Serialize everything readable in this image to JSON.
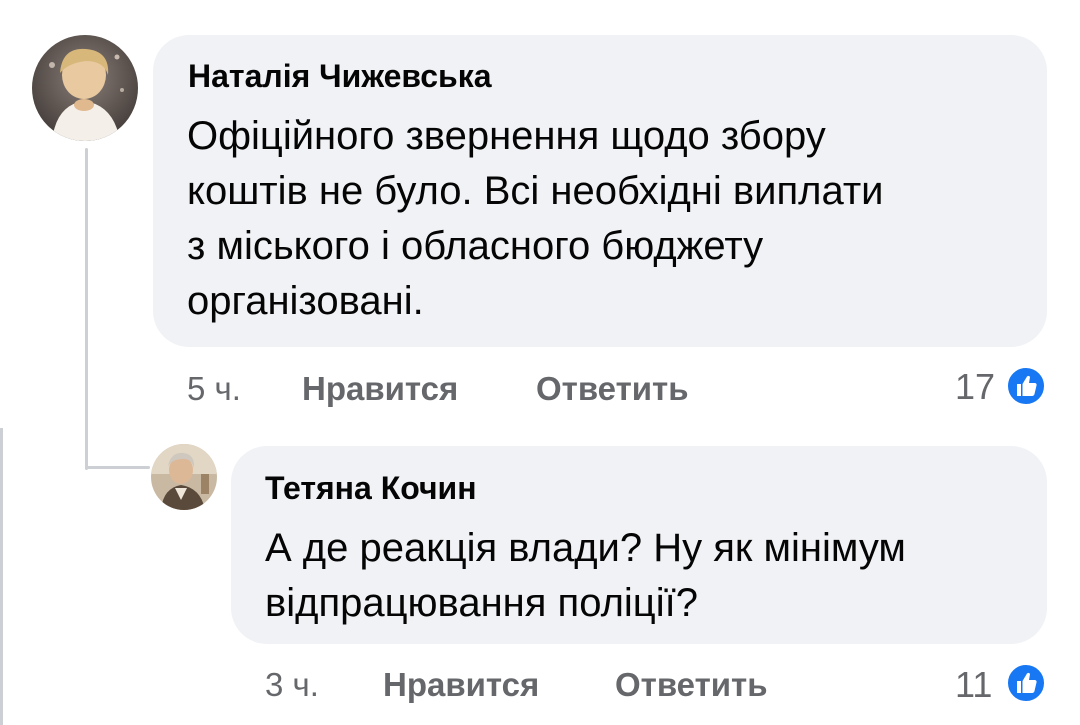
{
  "comments": [
    {
      "author": "Наталія Чижевська",
      "text": "Офіційного звернення щодо збору\nкоштів не було. Всі необхідні виплати\nз міського і обласного бюджету\nорганізовані.",
      "time": "5 ч.",
      "like_label": "Нравится",
      "reply_label": "Ответить",
      "reaction_count": "17",
      "avatar_icon": "user-avatar"
    },
    {
      "author": "Тетяна Кочин",
      "text": "А де реакція влади? Ну як мінімум\nвідпрацювання поліції?",
      "time": "3 ч.",
      "like_label": "Нравится",
      "reply_label": "Ответить",
      "reaction_count": "11",
      "avatar_icon": "user-avatar"
    }
  ],
  "colors": {
    "bubble": "#f0f2f5",
    "meta_text": "#65676b",
    "like_blue": "#1877f2",
    "thread_line": "#ccd0d5"
  },
  "icons": {
    "reaction": "like-thumb-icon"
  }
}
